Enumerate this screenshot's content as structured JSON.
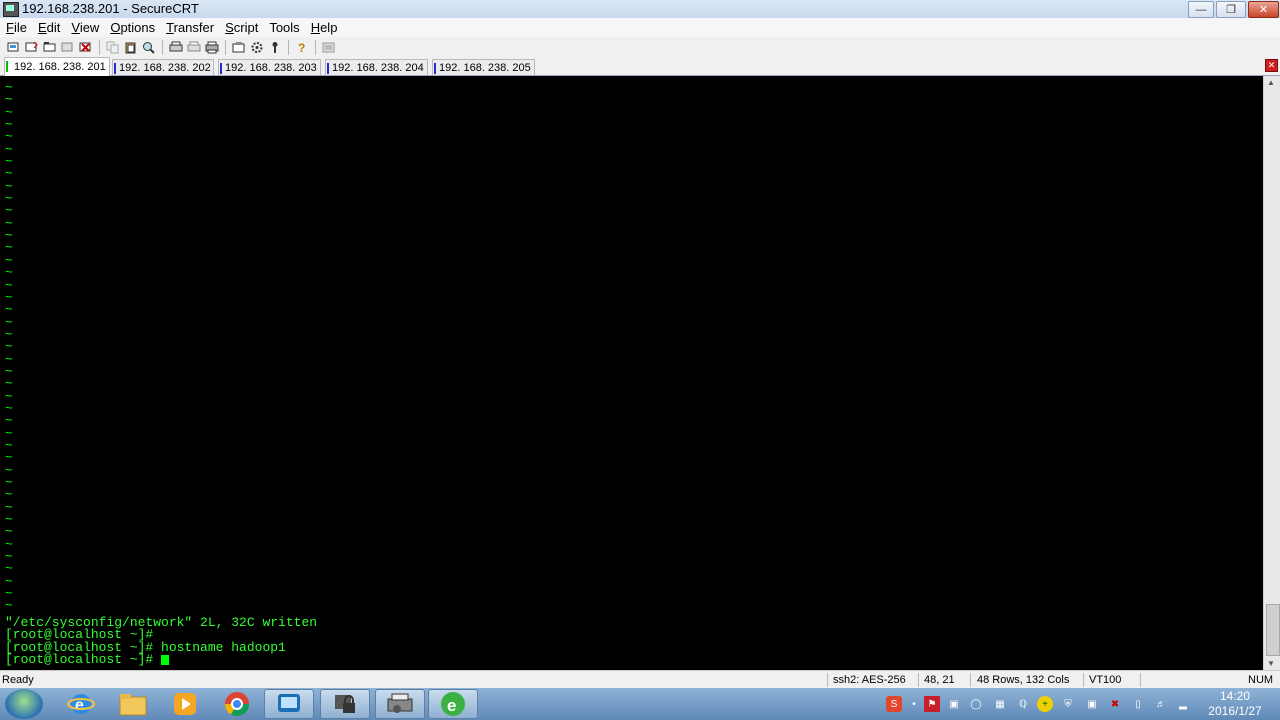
{
  "window": {
    "title": "192.168.238.201 - SecureCRT"
  },
  "menu": {
    "items": [
      {
        "underline": "F",
        "rest": "ile"
      },
      {
        "underline": "E",
        "rest": "dit"
      },
      {
        "underline": "V",
        "rest": "iew"
      },
      {
        "underline": "O",
        "rest": "ptions"
      },
      {
        "underline": "T",
        "rest": "ransfer"
      },
      {
        "underline": "S",
        "rest": "cript"
      },
      {
        "underline": "",
        "rest": "Tools"
      },
      {
        "underline": "H",
        "rest": "elp"
      }
    ]
  },
  "toolbar": {
    "icons": [
      "connect-icon",
      "quick-connect-icon",
      "connect-tab-icon",
      "reconnect-icon",
      "disconnect-icon",
      "copy-icon",
      "paste-icon",
      "find-icon",
      "print-setup-icon",
      "print-selection-icon",
      "print-icon",
      "session-options-icon",
      "global-options-icon",
      "keymap-icon",
      "help-icon",
      "sftp-icon"
    ]
  },
  "tabs": [
    {
      "label": "192. 168. 238. 201",
      "active": true,
      "marker": "green"
    },
    {
      "label": "192. 168. 238. 202",
      "active": false,
      "marker": "blue"
    },
    {
      "label": "192. 168. 238. 203",
      "active": false,
      "marker": "blue"
    },
    {
      "label": "192. 168. 238. 204",
      "active": false,
      "marker": "blue"
    },
    {
      "label": "192. 168. 238. 205",
      "active": false,
      "marker": "blue"
    }
  ],
  "terminal": {
    "tilde_char": "~",
    "tilde_count": 43,
    "lines": [
      "\"/etc/sysconfig/network\" 2L, 32C written",
      "[root@localhost ~]#",
      "[root@localhost ~]# hostname hadoop1",
      "[root@localhost ~]# "
    ],
    "text_color": "#33ff33",
    "background": "#000000"
  },
  "status": {
    "ready": "Ready",
    "encryption": "ssh2: AES-256",
    "cursor_pos": "48,  21",
    "dimensions": "48 Rows, 132 Cols",
    "emulation": "VT100",
    "num": "NUM"
  },
  "taskbar": {
    "apps": [
      "ie-icon",
      "explorer-folder-icon",
      "media-player-icon",
      "chrome-icon",
      "securecrt-icon",
      "vpn-lock-icon",
      "printer-app-icon",
      "refresh-browser-icon"
    ],
    "clock_time": "14:20",
    "clock_date": "2016/1/27"
  }
}
